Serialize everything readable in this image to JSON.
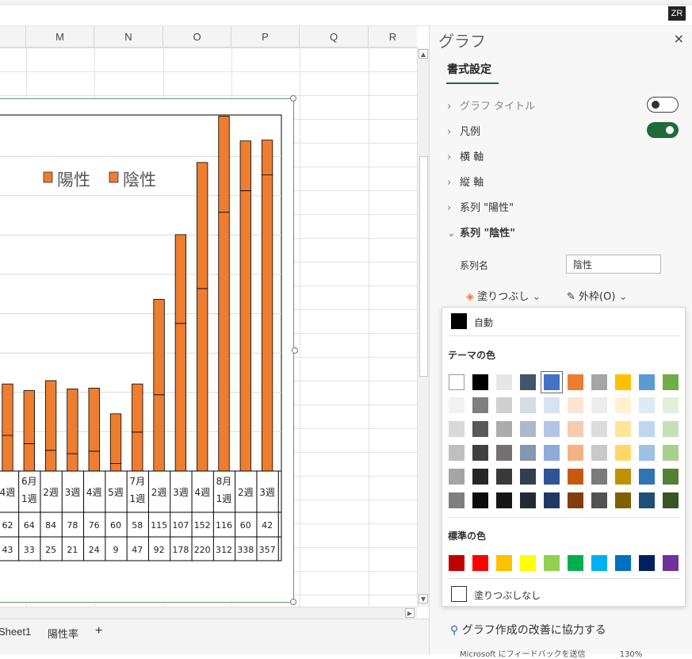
{
  "user_initials": "ZR",
  "columns": [
    "M",
    "N",
    "O",
    "P",
    "Q",
    "R"
  ],
  "sheet_tabs": [
    "Sheet1",
    "陽性率"
  ],
  "add_sheet": "+",
  "chart_data": {
    "type": "bar",
    "legend": [
      "陽性",
      "陰性"
    ],
    "series_colors": [
      "#ED7D31",
      "#ED7D31"
    ],
    "categories": [
      "4週",
      "6月\n1週",
      "2週",
      "3週",
      "4週",
      "5週",
      "7月\n1週",
      "2週",
      "3週",
      "4週",
      "8月\n1週",
      "2週",
      "3週"
    ],
    "series": [
      {
        "name": "陽性",
        "values": [
          62,
          64,
          84,
          78,
          76,
          60,
          58,
          115,
          107,
          152,
          116,
          60,
          42
        ]
      },
      {
        "name": "陰性",
        "values": [
          43,
          33,
          25,
          21,
          24,
          9,
          47,
          92,
          178,
          220,
          312,
          338,
          357
        ]
      }
    ],
    "stacked": true,
    "grid": true,
    "legend_position": "top"
  },
  "pane": {
    "title": "グラフ",
    "close": "×",
    "tab": "書式設定",
    "sections": [
      {
        "label": "グラフ タイトル",
        "dim": true
      },
      {
        "label": "凡例"
      },
      {
        "label": "横 軸"
      },
      {
        "label": "縦 軸"
      },
      {
        "label": "系列 \"陽性\""
      },
      {
        "label": "系列 \"陰性\"",
        "expanded": true
      }
    ],
    "series_name_label": "系列名",
    "series_name_value": "陰性",
    "fill_label": "塗りつぶし",
    "border_label": "外枠(O)",
    "feedback": "グラフ作成の改善に協力する"
  },
  "color_picker": {
    "auto_label": "自動",
    "theme_header": "テーマの色",
    "standard_header": "標準の色",
    "no_fill_label": "塗りつぶしなし",
    "theme_rows": [
      [
        "#FFFFFF",
        "#000000",
        "#E7E6E6",
        "#44546A",
        "#4472C4",
        "#ED7D31",
        "#A5A5A5",
        "#FFC000",
        "#5B9BD5",
        "#70AD47"
      ],
      [
        "#F2F2F2",
        "#7F7F7F",
        "#D0CECE",
        "#D6DCE4",
        "#D9E2F3",
        "#FBE5D5",
        "#EDEDED",
        "#FFF2CC",
        "#DEEBF6",
        "#E2EFD9"
      ],
      [
        "#D8D8D8",
        "#595959",
        "#AEABAB",
        "#ADB9CA",
        "#B4C6E7",
        "#F7CBAC",
        "#DBDBDB",
        "#FEE599",
        "#BDD7EE",
        "#C5E0B3"
      ],
      [
        "#BFBFBF",
        "#3F3F3F",
        "#757070",
        "#8496B0",
        "#8EAADB",
        "#F4B183",
        "#C9C9C9",
        "#FFD965",
        "#9CC3E5",
        "#A8D08D"
      ],
      [
        "#A5A5A5",
        "#262626",
        "#3A3838",
        "#323F4F",
        "#2F5496",
        "#C55A11",
        "#7B7B7B",
        "#BF9000",
        "#2E75B5",
        "#538135"
      ],
      [
        "#7F7F7F",
        "#0C0C0C",
        "#171616",
        "#222A35",
        "#1F3864",
        "#833C0B",
        "#525252",
        "#7F6000",
        "#1E4E79",
        "#375623"
      ]
    ],
    "standard_colors": [
      "#C00000",
      "#FF0000",
      "#FFC000",
      "#FFFF00",
      "#92D050",
      "#00B050",
      "#00B0F0",
      "#0070C0",
      "#002060",
      "#7030A0"
    ]
  },
  "status_text": "Microsoft にフィードバックを送信",
  "zoom_text": "130%"
}
